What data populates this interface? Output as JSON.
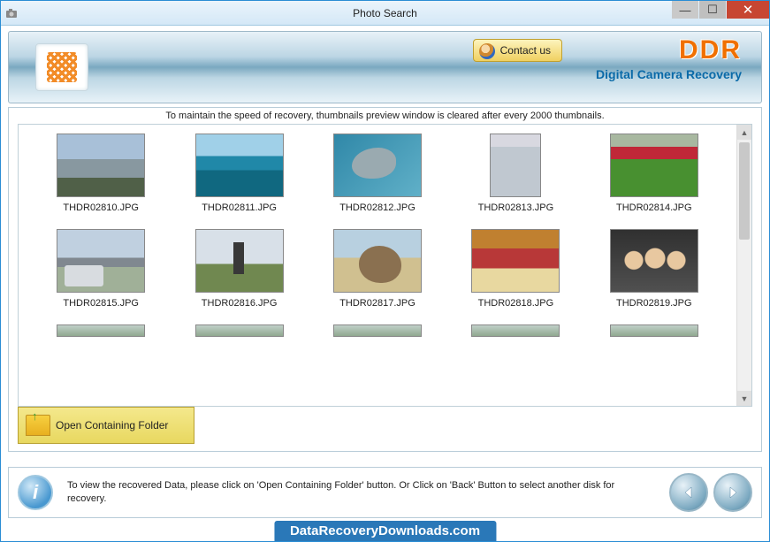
{
  "window": {
    "title": "Photo Search"
  },
  "header": {
    "contact_label": "Contact us",
    "brand_top": "DDR",
    "brand_sub": "Digital Camera Recovery"
  },
  "info_strip": "To maintain the speed of recovery, thumbnails preview window is cleared after every 2000 thumbnails.",
  "thumbnails": [
    {
      "filename": "THDR02810.JPG"
    },
    {
      "filename": "THDR02811.JPG"
    },
    {
      "filename": "THDR02812.JPG"
    },
    {
      "filename": "THDR02813.JPG"
    },
    {
      "filename": "THDR02814.JPG"
    },
    {
      "filename": "THDR02815.JPG"
    },
    {
      "filename": "THDR02816.JPG"
    },
    {
      "filename": "THDR02817.JPG"
    },
    {
      "filename": "THDR02818.JPG"
    },
    {
      "filename": "THDR02819.JPG"
    }
  ],
  "open_folder_label": "Open Containing Folder",
  "footer_text": "To view the recovered Data, please click on 'Open Containing Folder' button. Or Click on 'Back' Button to select another disk for recovery.",
  "watermark": "DataRecoveryDownloads.com"
}
